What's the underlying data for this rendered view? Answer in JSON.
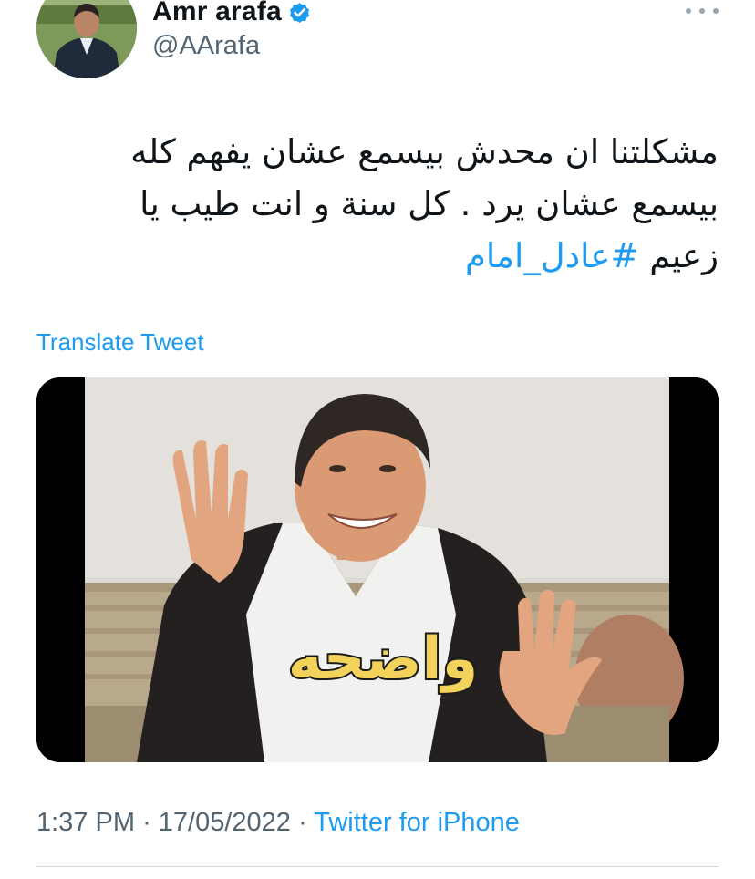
{
  "author": {
    "display_name": "Amr arafa",
    "handle": "@AArafa",
    "verified": true,
    "avatar_icon": "profile-photo"
  },
  "tweet": {
    "text": "مشكلتنا ان محدش بيسمع عشان يفهم كله بيسمع عشان يرد . كل سنة و انت طيب يا زعيم",
    "hashtag": "#عادل_امام",
    "translate_label": "Translate Tweet",
    "image_caption": "واضحه"
  },
  "meta": {
    "time": "1:37 PM",
    "separator": "·",
    "date": "17/05/2022",
    "source": "Twitter for iPhone"
  },
  "colors": {
    "accent": "#1d9bf0",
    "text_primary": "#0f1419",
    "text_secondary": "#536471",
    "divider": "#cfd9de"
  }
}
